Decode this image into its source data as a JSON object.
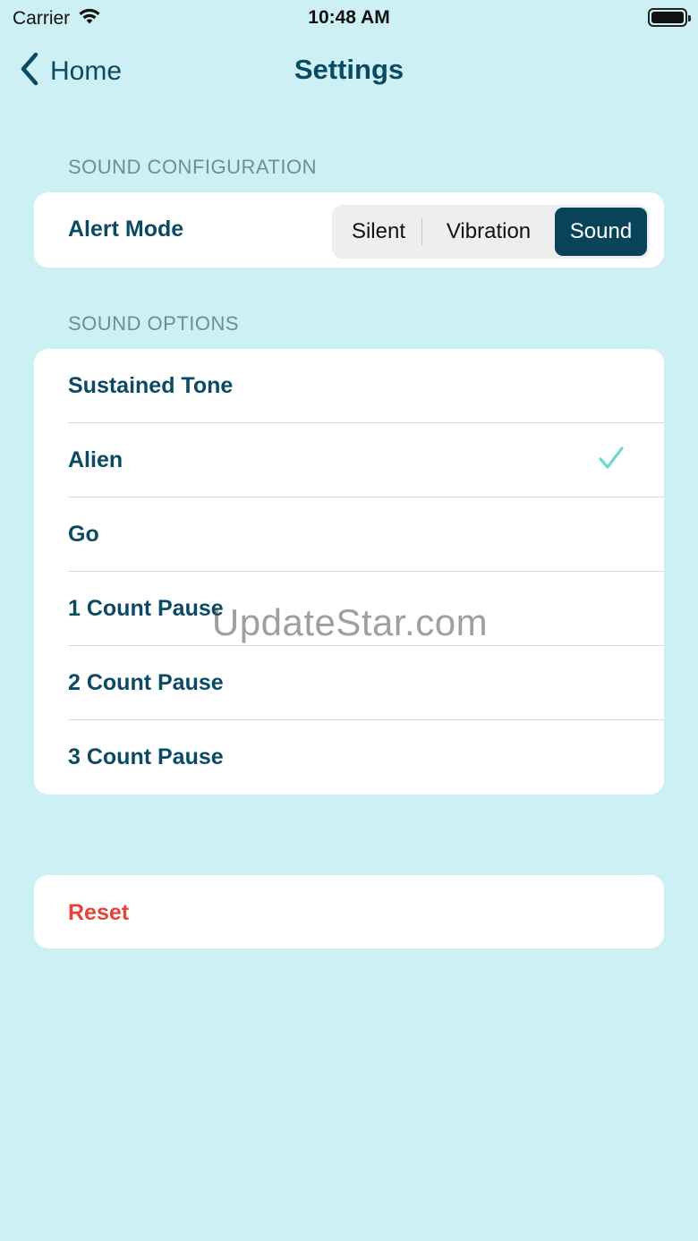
{
  "status_bar": {
    "carrier": "Carrier",
    "time": "10:48 AM"
  },
  "nav": {
    "back_label": "Home",
    "title": "Settings"
  },
  "sound_configuration": {
    "header": "SOUND CONFIGURATION",
    "alert_mode_label": "Alert Mode",
    "segments": [
      "Silent",
      "Vibration",
      "Sound"
    ],
    "selected_segment": "Sound"
  },
  "sound_options": {
    "header": "SOUND OPTIONS",
    "items": [
      {
        "label": "Sustained Tone",
        "checked": false
      },
      {
        "label": "Alien",
        "checked": true
      },
      {
        "label": "Go",
        "checked": false
      },
      {
        "label": "1 Count Pause",
        "checked": false
      },
      {
        "label": "2 Count Pause",
        "checked": false
      },
      {
        "label": "3 Count Pause",
        "checked": false
      }
    ]
  },
  "reset": {
    "label": "Reset"
  },
  "watermark": "UpdateStar.com",
  "colors": {
    "background": "#cdf0f5",
    "primary": "#0b4a63",
    "segment_active": "#08435a",
    "checkmark": "#6fd6d6",
    "destructive": "#e8423b"
  },
  "icons": {
    "back": "chevron-left-icon",
    "wifi": "wifi-icon",
    "battery": "battery-icon",
    "check": "checkmark-icon"
  }
}
